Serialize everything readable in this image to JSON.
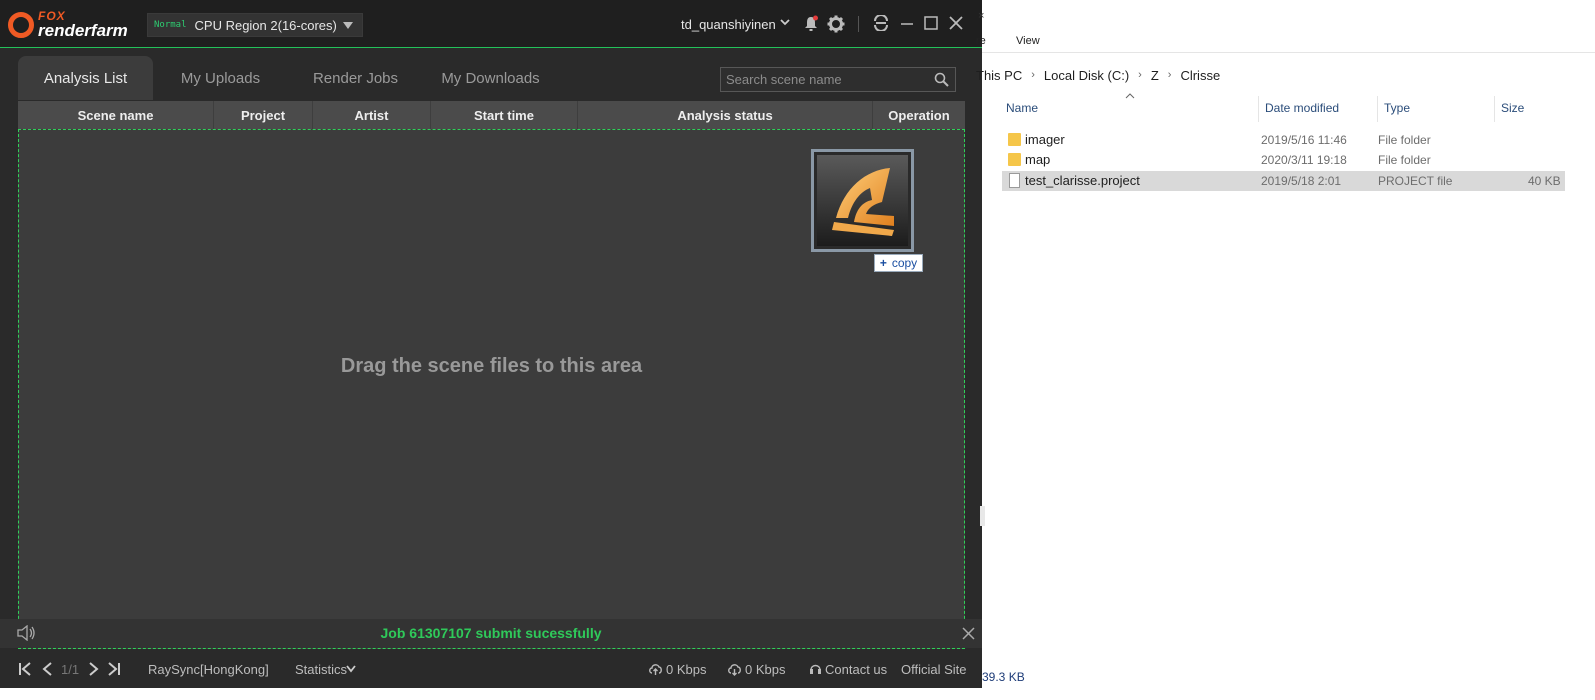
{
  "app": {
    "logo": {
      "brand_top": "FOX",
      "brand_bottom": "renderfarm"
    },
    "region": {
      "tag": "Normal",
      "name": "CPU Region 2(16-cores)"
    },
    "user": {
      "name": "td_quanshiyinen"
    },
    "tabs": [
      {
        "label": "Analysis List",
        "active": true
      },
      {
        "label": "My Uploads",
        "active": false
      },
      {
        "label": "Render Jobs",
        "active": false
      },
      {
        "label": "My Downloads",
        "active": false
      }
    ],
    "search": {
      "placeholder": "Search scene name",
      "value": ""
    },
    "columns": [
      "Scene name",
      "Project",
      "Artist",
      "Start time",
      "Analysis status",
      "Operation"
    ],
    "drop_area": {
      "message": "Drag the scene files to this area",
      "copy_badge": "copy"
    },
    "notice": {
      "message": "Job 61307107 submit sucessfully"
    },
    "bottom": {
      "page": "1/1",
      "transfer_line": "RaySync[HongKong]",
      "statistics": "Statistics",
      "upload_speed": "0 Kbps",
      "download_speed": "0 Kbps",
      "contact": "Contact us",
      "official_site": "Official Site"
    },
    "colors": {
      "accent_green": "#23c15a",
      "brand_orange": "#f05a24",
      "background": "#2a2a2a"
    }
  },
  "explorer": {
    "ribbon": {
      "share_fragment": "re",
      "view": "View"
    },
    "breadcrumb": [
      "This PC",
      "Local Disk (C:)",
      "Z",
      "Clrisse"
    ],
    "columns": [
      "Name",
      "Date modified",
      "Type",
      "Size"
    ],
    "files": [
      {
        "name": "imager",
        "date": "2019/5/16 11:46",
        "type": "File folder",
        "size": "",
        "kind": "folder"
      },
      {
        "name": "map",
        "date": "2020/3/11 19:18",
        "type": "File folder",
        "size": "",
        "kind": "folder"
      },
      {
        "name": "test_clarisse.project",
        "date": "2019/5/18 2:01",
        "type": "PROJECT file",
        "size": "40 KB",
        "kind": "file",
        "selected": true
      }
    ],
    "status": {
      "size_fragment": "39.3 KB"
    }
  }
}
